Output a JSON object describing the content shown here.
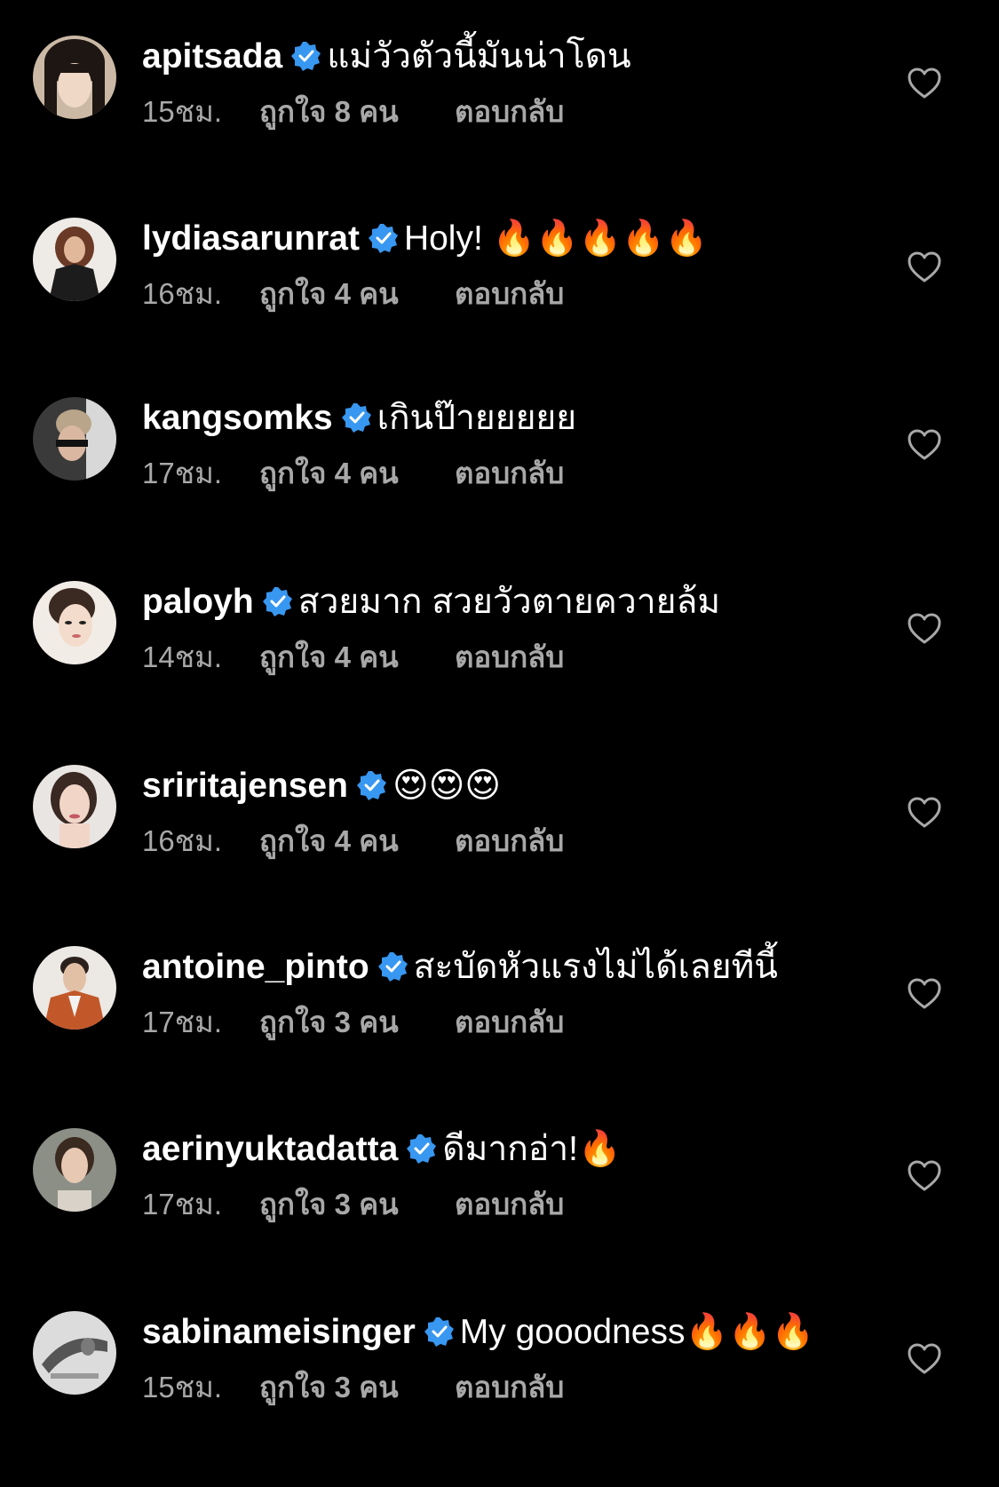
{
  "colors": {
    "background": "#000000",
    "text": "#ffffff",
    "meta": "#a8a8a8",
    "verified": "#3897f0"
  },
  "comments": [
    {
      "username": "apitsada",
      "verified": true,
      "text": "แม่วัวตัวนี้มันน่าโดน",
      "time": "15ชม.",
      "likes": "ถูกใจ 8 คน",
      "reply": "ตอบกลับ"
    },
    {
      "username": "lydiasarunrat",
      "verified": true,
      "text": "Holy! 🔥🔥🔥🔥🔥",
      "time": "16ชม.",
      "likes": "ถูกใจ 4 คน",
      "reply": "ตอบกลับ"
    },
    {
      "username": "kangsomks",
      "verified": true,
      "text": "เกินป๊ายยยยย",
      "time": "17ชม.",
      "likes": "ถูกใจ 4 คน",
      "reply": "ตอบกลับ"
    },
    {
      "username": "paloyh",
      "verified": true,
      "text": "สวยมาก สวยวัวตายควายล้ม",
      "time": "14ชม.",
      "likes": "ถูกใจ 4 คน",
      "reply": "ตอบกลับ"
    },
    {
      "username": "sriritajensen",
      "verified": true,
      "text": "😍😍😍",
      "time": "16ชม.",
      "likes": "ถูกใจ 4 คน",
      "reply": "ตอบกลับ"
    },
    {
      "username": "antoine_pinto",
      "verified": true,
      "text": "สะบัดหัวแรงไม่ได้เลยทีนี้",
      "time": "17ชม.",
      "likes": "ถูกใจ 3 คน",
      "reply": "ตอบกลับ"
    },
    {
      "username": "aerinyuktadatta",
      "verified": true,
      "text": "ดีมากอ่า!🔥",
      "time": "17ชม.",
      "likes": "ถูกใจ 3 คน",
      "reply": "ตอบกลับ"
    },
    {
      "username": "sabinameisinger",
      "verified": true,
      "text": "My gooodness🔥🔥🔥",
      "time": "15ชม.",
      "likes": "ถูกใจ 3 คน",
      "reply": "ตอบกลับ"
    }
  ]
}
